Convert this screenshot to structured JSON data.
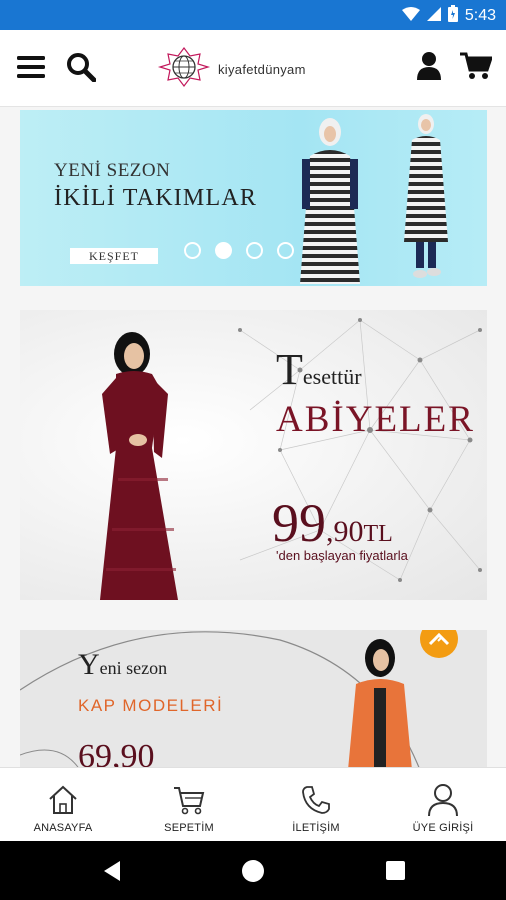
{
  "status_bar": {
    "time": "5:43"
  },
  "header": {
    "logo_text": "kiyafetdünyam",
    "menu_icon": "menu-icon",
    "search_icon": "search-icon",
    "user_icon": "user-icon",
    "cart_icon": "cart-icon"
  },
  "banners": {
    "slide": {
      "line1": "YENİ SEZON",
      "line2": "İKİLİ TAKIMLAR",
      "button": "KEŞFET",
      "dots_total": 5,
      "active_dot": 2
    },
    "abiye": {
      "title_big": "T",
      "title_rest": "esettür",
      "subtitle": "ABİYELER",
      "price_main": "99",
      "price_decimal": ",90",
      "currency": "TL",
      "note": "'den başlayan fiyatlarla"
    },
    "kap": {
      "line1_big": "Y",
      "line1_rest": "eni sezon",
      "line2": "KAP MODELERİ",
      "price_partial": "69,90"
    }
  },
  "bottom_nav": [
    {
      "label": "ANASAYFA",
      "icon": "home-icon"
    },
    {
      "label": "SEPETİM",
      "icon": "cart-icon"
    },
    {
      "label": "İLETİŞİM",
      "icon": "phone-icon"
    },
    {
      "label": "ÜYE GİRİŞİ",
      "icon": "user-icon"
    }
  ],
  "colors": {
    "status_bar": "#1976d2",
    "abiye_text": "#7a1426",
    "kap_accent": "#e0662a",
    "scroll_top_button": "#f39c12"
  }
}
